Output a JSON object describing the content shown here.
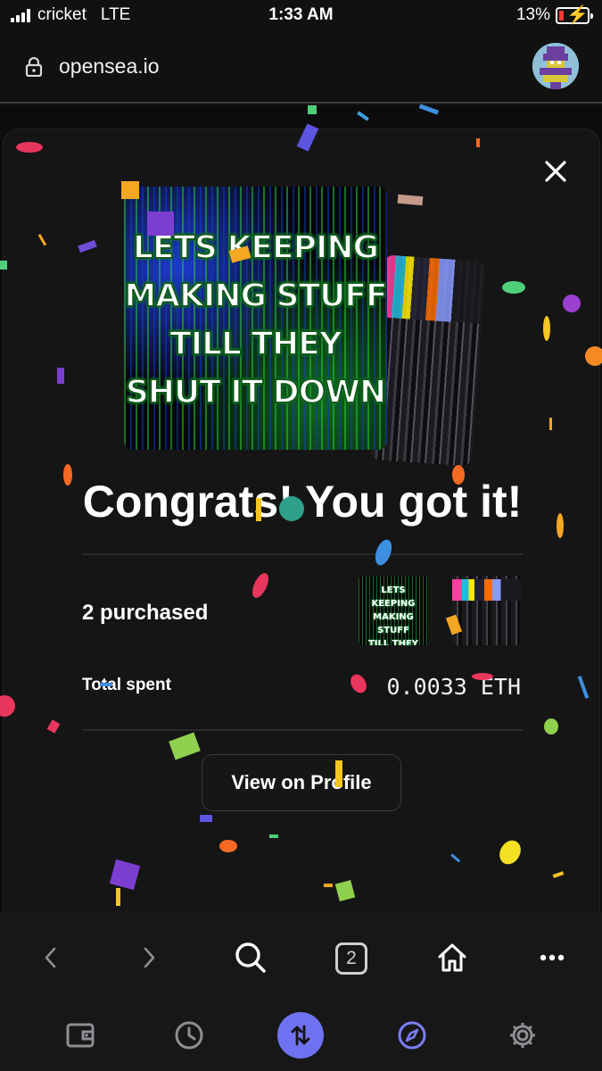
{
  "status_bar": {
    "carrier": "cricket",
    "network": "LTE",
    "time": "1:33 AM",
    "battery_percent": "13%",
    "battery_level": 0.13
  },
  "address_bar": {
    "url": "opensea.io",
    "lock_icon": "lock-icon",
    "avatar_icon": "account-avatar"
  },
  "modal": {
    "close_icon": "close-icon",
    "nft_primary_text": "LETS KEEPING\nMAKING STUFF\nTILL THEY\nSHUT IT DOWN",
    "heading": "Congrats! You got it!",
    "purchased_label": "2 purchased",
    "total_spent_label": "Total spent",
    "total_spent_value": "0.0033 ETH",
    "view_button_label": "View on Profile"
  },
  "toolbar": {
    "back_icon": "chevron-left-icon",
    "forward_icon": "chevron-right-icon",
    "search_icon": "search-icon",
    "tabs_count": "2",
    "home_icon": "home-icon",
    "more_icon": "more-icon",
    "wallet_icon": "wallet-icon",
    "history_icon": "clock-icon",
    "swap_icon": "swap-icon",
    "browser_icon": "compass-icon",
    "settings_icon": "gear-icon"
  },
  "colors": {
    "background": "#121212",
    "accent": "#6f72f0",
    "battery_low": "#ff3b30"
  }
}
